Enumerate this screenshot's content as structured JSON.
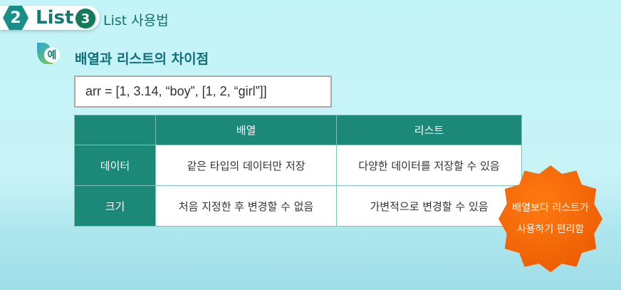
{
  "header": {
    "chapter_num": "2",
    "chapter": "List",
    "section_num": "3",
    "section": "List 사용법"
  },
  "example": {
    "icon_label": "예",
    "title": "배열과 리스트의 차이점",
    "code": "arr = [1, 3.14, “boy”, [1, 2, “girl”]]"
  },
  "table": {
    "headers": [
      "",
      "배열",
      "리스트"
    ],
    "rows": [
      {
        "label": "데이터",
        "cells": [
          "같은 타입의 데이터만 저장",
          "다양한 데이터를 저장할 수 있음"
        ]
      },
      {
        "label": "크기",
        "cells": [
          "처음 지정한 후 변경할 수 없음",
          "가변적으로 변경할 수 있음"
        ]
      }
    ]
  },
  "badge": {
    "line1": "배열보다 리스트가",
    "line2": "사용하기 편리함"
  },
  "colors": {
    "teal": "#1b8878",
    "orange": "#f06000",
    "background": "#c6f3f7"
  }
}
